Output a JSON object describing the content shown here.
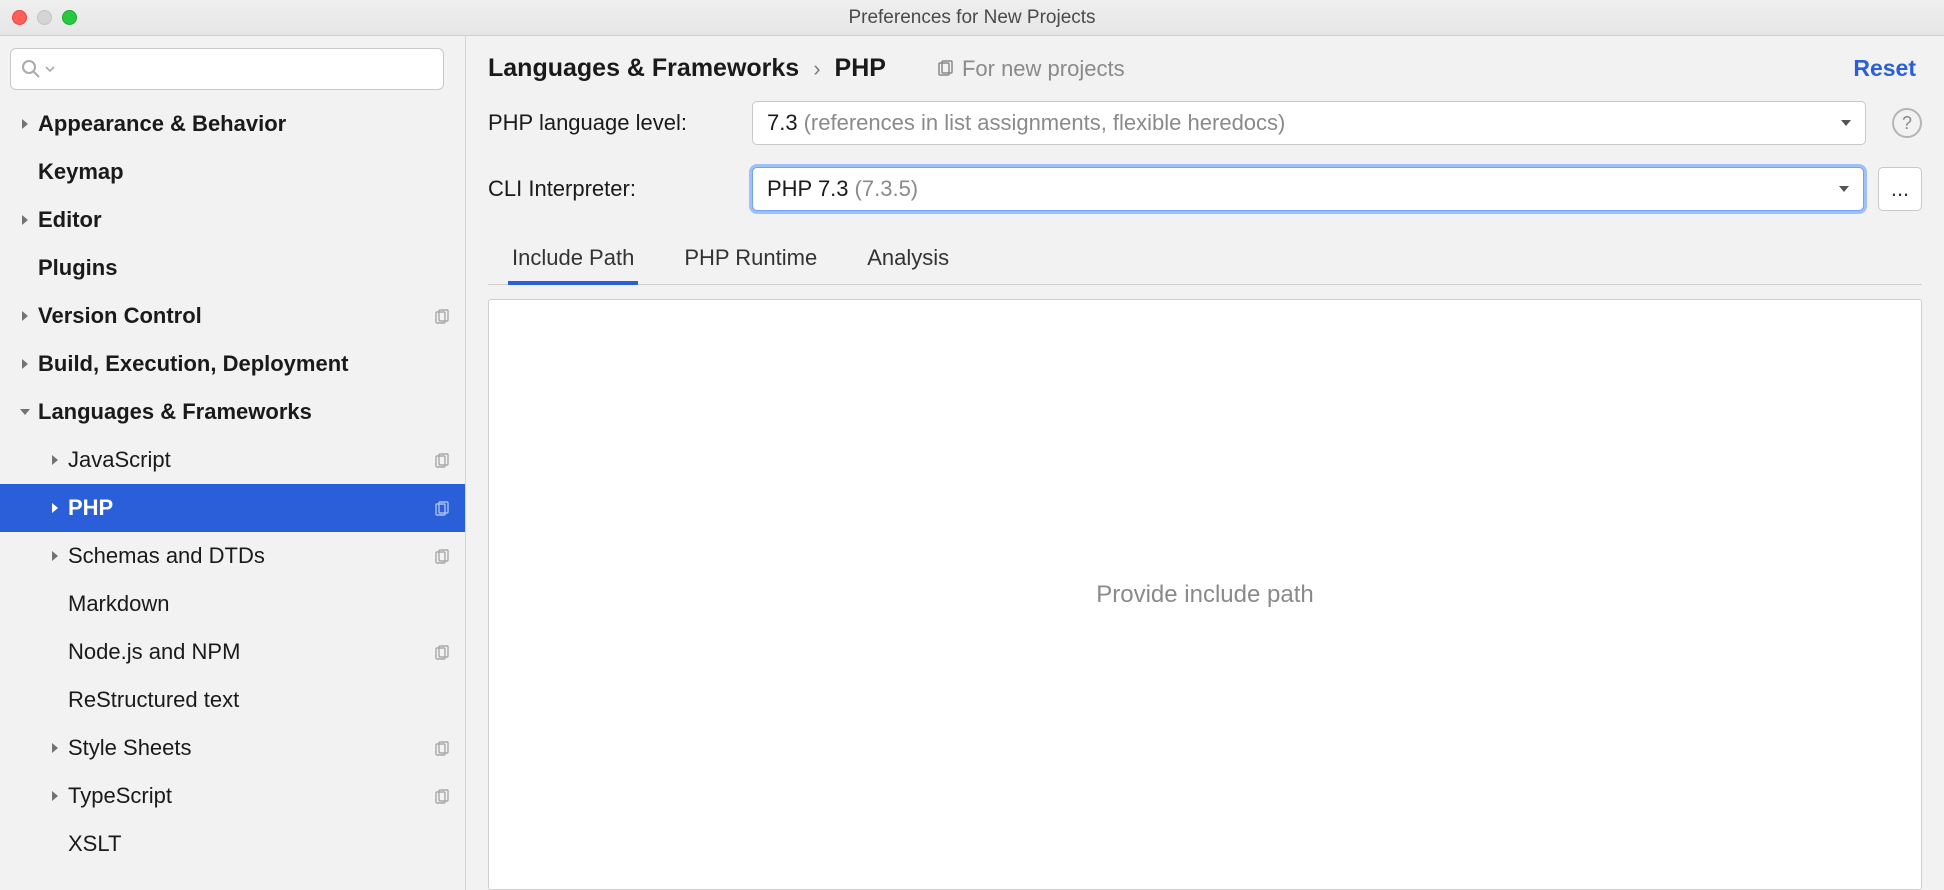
{
  "window": {
    "title": "Preferences for New Projects"
  },
  "search": {
    "placeholder": ""
  },
  "sidebar": {
    "items": [
      {
        "label": "Appearance & Behavior",
        "depth": 0,
        "expandable": true,
        "expanded": false
      },
      {
        "label": "Keymap",
        "depth": 0,
        "expandable": false
      },
      {
        "label": "Editor",
        "depth": 0,
        "expandable": true,
        "expanded": false
      },
      {
        "label": "Plugins",
        "depth": 0,
        "expandable": false
      },
      {
        "label": "Version Control",
        "depth": 0,
        "expandable": true,
        "expanded": false,
        "copy": true
      },
      {
        "label": "Build, Execution, Deployment",
        "depth": 0,
        "expandable": true,
        "expanded": false
      },
      {
        "label": "Languages & Frameworks",
        "depth": 0,
        "expandable": true,
        "expanded": true
      },
      {
        "label": "JavaScript",
        "depth": 1,
        "expandable": true,
        "expanded": false,
        "copy": true
      },
      {
        "label": "PHP",
        "depth": 1,
        "expandable": true,
        "expanded": false,
        "copy": true,
        "selected": true
      },
      {
        "label": "Schemas and DTDs",
        "depth": 1,
        "expandable": true,
        "expanded": false,
        "copy": true
      },
      {
        "label": "Markdown",
        "depth": 1,
        "expandable": false
      },
      {
        "label": "Node.js and NPM",
        "depth": 1,
        "expandable": false,
        "copy": true
      },
      {
        "label": "ReStructured text",
        "depth": 1,
        "expandable": false
      },
      {
        "label": "Style Sheets",
        "depth": 1,
        "expandable": true,
        "expanded": false,
        "copy": true
      },
      {
        "label": "TypeScript",
        "depth": 1,
        "expandable": true,
        "expanded": false,
        "copy": true
      },
      {
        "label": "XSLT",
        "depth": 1,
        "expandable": false
      }
    ]
  },
  "header": {
    "crumb1": "Languages & Frameworks",
    "sep": "›",
    "crumb2": "PHP",
    "fornew": "For new projects",
    "reset": "Reset"
  },
  "form": {
    "lang_level_label": "PHP language level:",
    "lang_level_main": "7.3",
    "lang_level_sub": "(references in list assignments, flexible heredocs)",
    "cli_label": "CLI Interpreter:",
    "cli_main": "PHP 7.3",
    "cli_sub": "(7.3.5)",
    "browse": "..."
  },
  "tabs": {
    "t0": "Include Path",
    "t1": "PHP Runtime",
    "t2": "Analysis"
  },
  "panel": {
    "placeholder": "Provide include path"
  }
}
